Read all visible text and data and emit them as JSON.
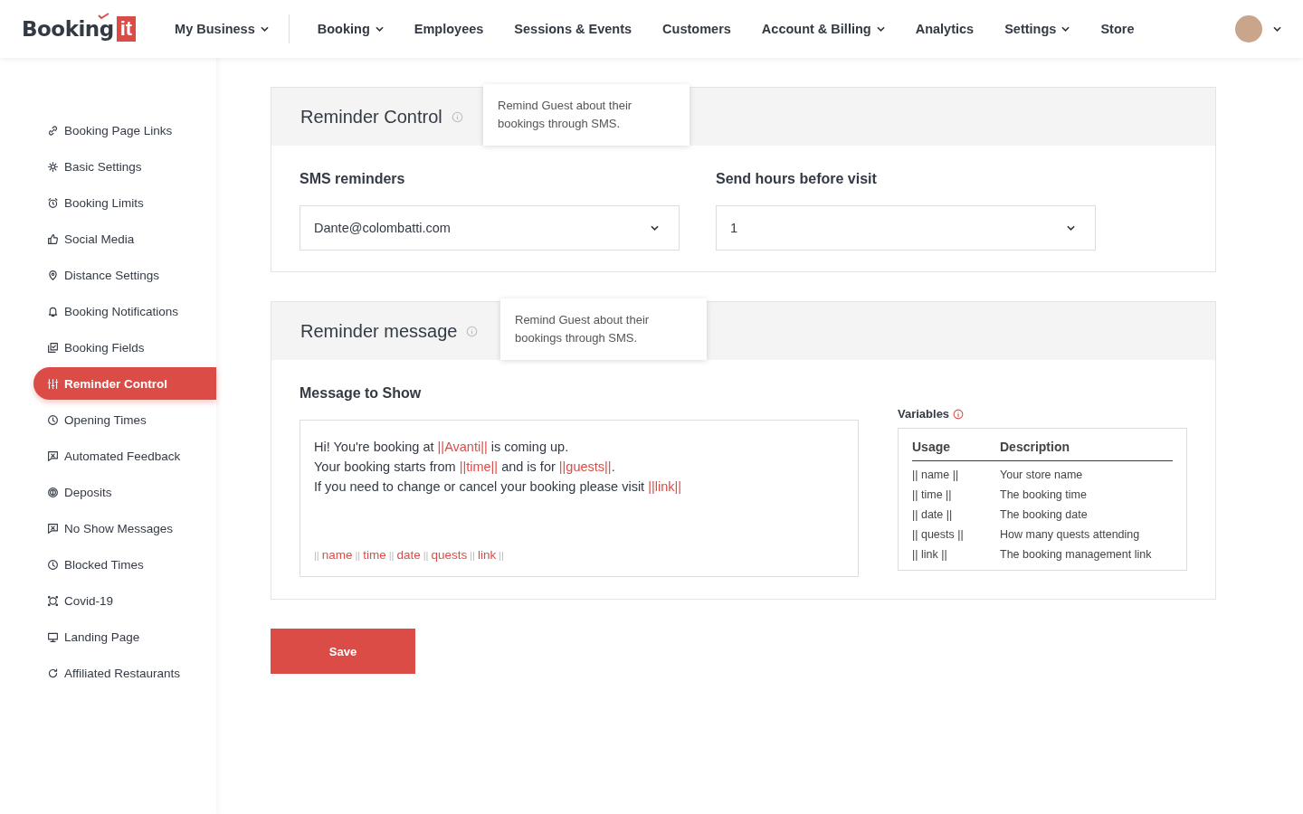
{
  "logo": {
    "word": "Booking",
    "badge": "it"
  },
  "nav": [
    {
      "label": "My Business",
      "dropdown": true
    },
    {
      "label": "Booking",
      "dropdown": true
    },
    {
      "label": "Employees",
      "dropdown": false
    },
    {
      "label": "Sessions & Events",
      "dropdown": false
    },
    {
      "label": "Customers",
      "dropdown": false
    },
    {
      "label": "Account & Billing",
      "dropdown": true
    },
    {
      "label": "Analytics",
      "dropdown": false
    },
    {
      "label": "Settings",
      "dropdown": true
    },
    {
      "label": "Store",
      "dropdown": false
    }
  ],
  "sidebar": {
    "items": [
      {
        "label": "Booking Page Links",
        "selected": false
      },
      {
        "label": "Basic Settings",
        "selected": false
      },
      {
        "label": "Booking Limits",
        "selected": false
      },
      {
        "label": "Social Media",
        "selected": false
      },
      {
        "label": "Distance Settings",
        "selected": false
      },
      {
        "label": "Booking Notifications",
        "selected": false
      },
      {
        "label": "Booking Fields",
        "selected": false
      },
      {
        "label": "Reminder Control",
        "selected": true
      },
      {
        "label": "Opening Times",
        "selected": false
      },
      {
        "label": "Automated Feedback",
        "selected": false
      },
      {
        "label": "Deposits",
        "selected": false
      },
      {
        "label": "No Show Messages",
        "selected": false
      },
      {
        "label": "Blocked Times",
        "selected": false
      },
      {
        "label": "Covid-19",
        "selected": false
      },
      {
        "label": "Landing Page",
        "selected": false
      },
      {
        "label": "Affiliated Restaurants",
        "selected": false
      }
    ]
  },
  "reminder_control": {
    "title": "Reminder Control",
    "tooltip": "Remind Guest about their bookings through SMS.",
    "fields": [
      {
        "label": "SMS reminders",
        "value": "Dante@colombatti.com"
      },
      {
        "label": "Send hours before visit",
        "value": "1"
      }
    ]
  },
  "reminder_message": {
    "title": "Reminder message",
    "tooltip": "Remind Guest about their bookings through SMS.",
    "message_label": "Message to Show",
    "message_lines": [
      [
        {
          "kind": "text",
          "text": "Hi! You're booking at "
        },
        {
          "kind": "variable",
          "text": "||Avanti||"
        },
        {
          "kind": "text",
          "text": " is coming up."
        }
      ],
      [
        {
          "kind": "text",
          "text": "Your booking starts from "
        },
        {
          "kind": "variable",
          "text": "||time||"
        },
        {
          "kind": "text",
          "text": " and is for "
        },
        {
          "kind": "variable",
          "text": "||guests||"
        },
        {
          "kind": "text",
          "text": "."
        }
      ],
      [
        {
          "kind": "text",
          "text": "If you need to change or cancel your booking please visit "
        },
        {
          "kind": "variable",
          "text": "||link||"
        }
      ]
    ],
    "variable_bar": [
      {
        "kind": "separator",
        "text": "||"
      },
      {
        "kind": "variable",
        "text": "name"
      },
      {
        "kind": "separator",
        "text": "||"
      },
      {
        "kind": "variable",
        "text": "time"
      },
      {
        "kind": "separator",
        "text": "||"
      },
      {
        "kind": "variable",
        "text": "date"
      },
      {
        "kind": "separator",
        "text": "||"
      },
      {
        "kind": "variable",
        "text": "quests"
      },
      {
        "kind": "separator",
        "text": "||"
      },
      {
        "kind": "variable",
        "text": "link"
      },
      {
        "kind": "separator",
        "text": "||"
      }
    ],
    "variables": {
      "title": "Variables",
      "columns": [
        "Usage",
        "Description"
      ],
      "rows": [
        [
          "|| name ||",
          "Your store name"
        ],
        [
          "|| time ||",
          "The booking time"
        ],
        [
          "|| date ||",
          "The booking date"
        ],
        [
          "|| quests ||",
          "How many quests attending"
        ],
        [
          "|| link ||",
          "The booking management link"
        ]
      ]
    }
  },
  "save_button": "Save"
}
